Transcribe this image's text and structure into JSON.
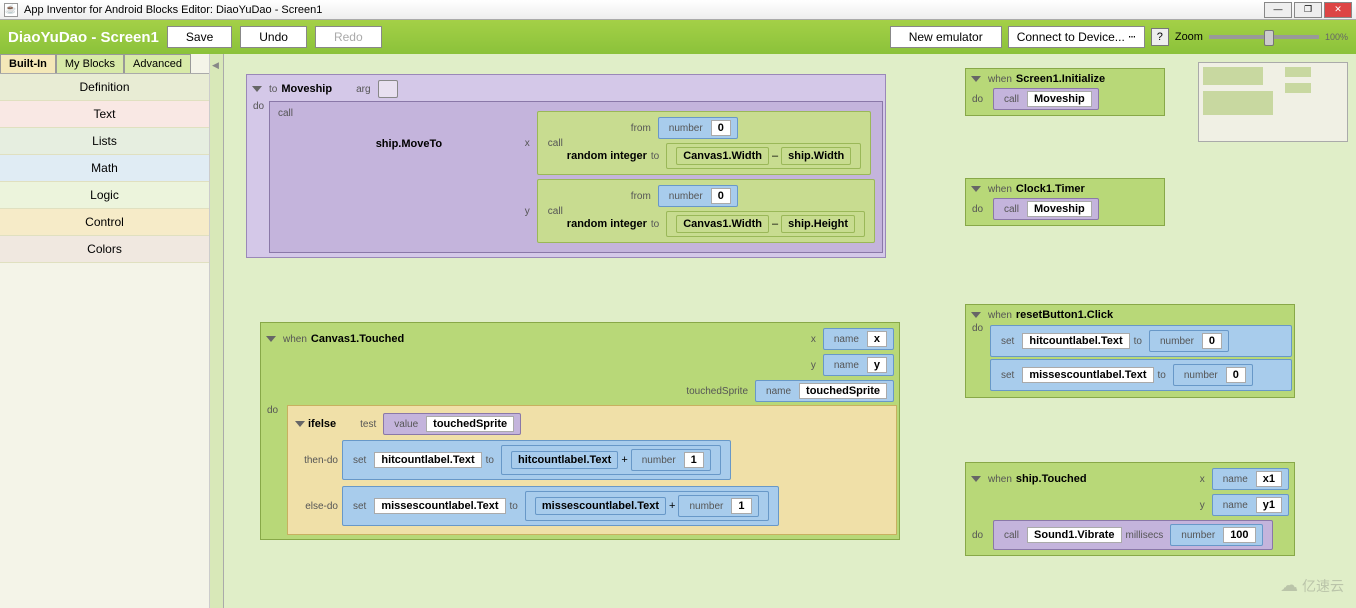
{
  "window": {
    "title": "App Inventor for Android Blocks Editor: DiaoYuDao - Screen1"
  },
  "toolbar": {
    "title": "DiaoYuDao - Screen1",
    "save": "Save",
    "undo": "Undo",
    "redo": "Redo",
    "new_emulator": "New emulator",
    "connect": "Connect to Device... ⵈ",
    "help": "?",
    "zoom_label": "Zoom",
    "zoom_pct": "100%"
  },
  "tabs": {
    "builtin": "Built-In",
    "myblocks": "My Blocks",
    "advanced": "Advanced"
  },
  "palette": {
    "definition": "Definition",
    "text": "Text",
    "lists": "Lists",
    "math": "Math",
    "logic": "Logic",
    "control": "Control",
    "colors": "Colors"
  },
  "blocks": {
    "moveship": {
      "to": "to",
      "name": "Moveship",
      "arg": "arg",
      "do": "do",
      "call": "call",
      "target": "ship.MoveTo",
      "x": "x",
      "y": "y",
      "random": "random integer",
      "from": "from",
      "to2": "to",
      "number": "number",
      "zero": "0",
      "canvas_w": "Canvas1.Width",
      "minus": "–",
      "ship_w": "ship.Width",
      "ship_h": "ship.Height"
    },
    "touched": {
      "when": "when",
      "name": "Canvas1.Touched",
      "x": "x",
      "y": "y",
      "namelbl": "name",
      "x_n": "x",
      "y_n": "y",
      "ts": "touchedSprite",
      "tsname": "touchedSprite",
      "do": "do",
      "ifelse": "ifelse",
      "test": "test",
      "value": "value",
      "then": "then-do",
      "else": "else-do",
      "set": "set",
      "to": "to",
      "hit": "hitcountlabel.Text",
      "miss": "missescountlabel.Text",
      "plus": "+",
      "number": "number",
      "one": "1"
    },
    "init": {
      "when": "when",
      "name": "Screen1.Initialize",
      "do": "do",
      "call": "call",
      "ms": "Moveship"
    },
    "timer": {
      "when": "when",
      "name": "Clock1.Timer",
      "do": "do",
      "call": "call",
      "ms": "Moveship"
    },
    "reset": {
      "when": "when",
      "name": "resetButton1.Click",
      "do": "do",
      "set": "set",
      "to": "to",
      "hit": "hitcountlabel.Text",
      "miss": "missescountlabel.Text",
      "number": "number",
      "zero": "0"
    },
    "shiptouch": {
      "when": "when",
      "name": "ship.Touched",
      "x": "x",
      "y": "y",
      "namelbl": "name",
      "x1": "x1",
      "y1": "y1",
      "do": "do",
      "call": "call",
      "vib": "Sound1.Vibrate",
      "ms": "millisecs",
      "number": "number",
      "hundred": "100"
    }
  },
  "watermark": {
    "brand": "亿速云"
  }
}
